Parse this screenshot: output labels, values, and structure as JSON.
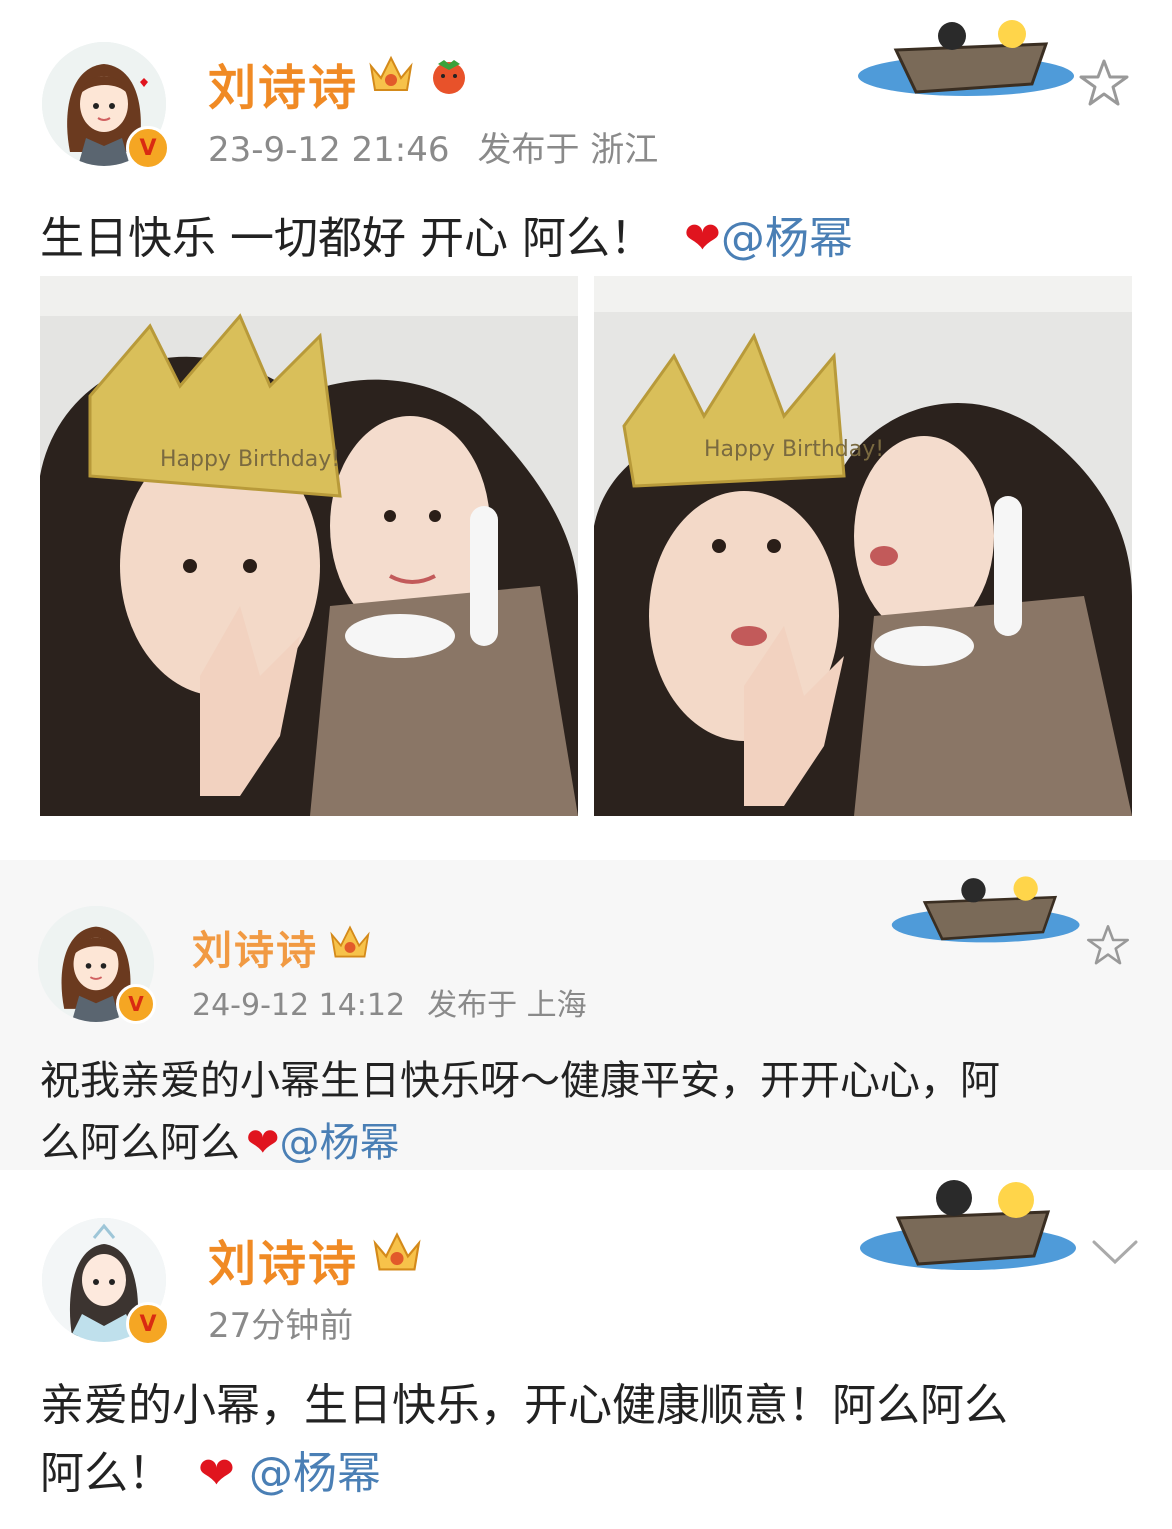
{
  "posts": [
    {
      "username": "刘诗诗",
      "time": "23-9-12 21:46",
      "location": "发布于 浙江",
      "text": "生日快乐 一切都好 开心 阿么！",
      "mention": "@杨幂",
      "verified_mark": "V",
      "photos": [
        {
          "crown_text": "Happy Birthday!"
        },
        {
          "crown_text": "Happy Birthday!"
        }
      ]
    },
    {
      "username": "刘诗诗",
      "time": "24-9-12 14:12",
      "location": "发布于 上海",
      "text_line1": "祝我亲爱的小幂生日快乐呀～健康平安，开开心心，阿",
      "text_line2": "么阿么阿么",
      "mention": "@杨幂",
      "verified_mark": "V"
    },
    {
      "username": "刘诗诗",
      "time": "27分钟前",
      "text_line1": "亲爱的小幂，生日快乐，开心健康顺意！阿么阿么",
      "text_line2": "阿么！",
      "mention": "@杨幂",
      "verified_mark": "V"
    }
  ],
  "colors": {
    "username": "#f08a24",
    "mention": "#4a7fb5",
    "heart": "#e0141e",
    "meta": "#8a8a8a"
  },
  "icons": [
    "avatar-icon",
    "crown-badge-icon",
    "verified-icon",
    "boat-decoration-icon",
    "star-icon",
    "chevron-down-icon",
    "heart-icon"
  ]
}
